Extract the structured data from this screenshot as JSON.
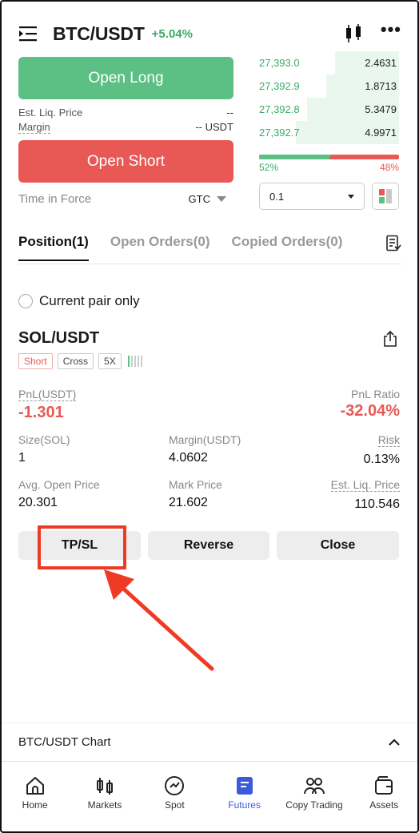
{
  "header": {
    "pair": "BTC/USDT",
    "change": "+5.04%"
  },
  "order_panel": {
    "open_long": "Open Long",
    "open_short": "Open Short",
    "est_liq_label": "Est. Liq. Price",
    "est_liq_value": "--",
    "margin_label": "Margin",
    "margin_value": "-- USDT",
    "tif_label": "Time in Force",
    "tif_value": "GTC"
  },
  "order_book": {
    "rows": [
      {
        "price": "27,393.0",
        "qty": "2.4631",
        "depth": 0.46
      },
      {
        "price": "27,392.9",
        "qty": "1.8713",
        "depth": 0.52
      },
      {
        "price": "27,392.8",
        "qty": "5.3479",
        "depth": 0.66
      },
      {
        "price": "27,392.7",
        "qty": "4.9971",
        "depth": 0.74
      }
    ],
    "buy_ratio": "52%",
    "sell_ratio": "48%",
    "buy_fraction": 0.52,
    "qty_select": "0.1"
  },
  "tabs": [
    "Position(1)",
    "Open Orders(0)",
    "Copied Orders(0)"
  ],
  "filter_label": "Current pair only",
  "position": {
    "symbol": "SOL/USDT",
    "side": "Short",
    "mode": "Cross",
    "leverage": "5X",
    "pnl_label": "PnL(USDT)",
    "pnl_value": "-1.301",
    "pnl_ratio_label": "PnL Ratio",
    "pnl_ratio_value": "-32.04%",
    "size_label": "Size(SOL)",
    "size_value": "1",
    "margin_label": "Margin(USDT)",
    "margin_value": "4.0602",
    "risk_label": "Risk",
    "risk_value": "0.13%",
    "avg_open_label": "Avg. Open Price",
    "avg_open_value": "20.301",
    "mark_label": "Mark Price",
    "mark_value": "21.602",
    "est_liq_label": "Est. Liq. Price",
    "est_liq_value": "110.546"
  },
  "actions": {
    "tpsl": "TP/SL",
    "reverse": "Reverse",
    "close": "Close"
  },
  "chart_toggle": "BTC/USDT Chart",
  "nav": [
    {
      "label": "Home",
      "icon": "home-icon"
    },
    {
      "label": "Markets",
      "icon": "markets-icon"
    },
    {
      "label": "Spot",
      "icon": "spot-icon"
    },
    {
      "label": "Futures",
      "icon": "futures-icon"
    },
    {
      "label": "Copy Trading",
      "icon": "copy-trading-icon"
    },
    {
      "label": "Assets",
      "icon": "assets-icon"
    }
  ],
  "colors": {
    "green": "#5cc084",
    "red": "#e85955",
    "accent": "#3b5bdb",
    "highlight": "#ef3b24"
  }
}
